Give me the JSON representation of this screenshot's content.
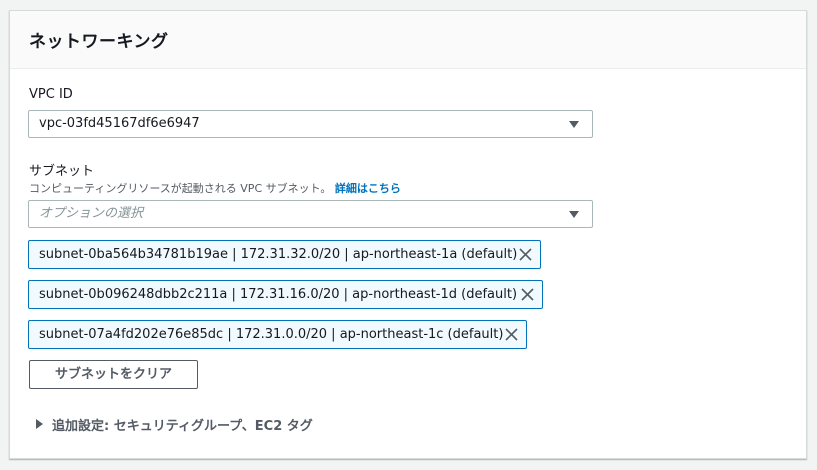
{
  "section": {
    "title": "ネットワーキング"
  },
  "vpc": {
    "label": "VPC ID",
    "value": "vpc-03fd45167df6e6947"
  },
  "subnet": {
    "label": "サブネット",
    "description": "コンピューティングリソースが起動される VPC サブネット。",
    "learn_more": "詳細はこちら",
    "placeholder": "オプションの選択",
    "selected": [
      "subnet-0ba564b34781b19ae | 172.31.32.0/20 | ap-northeast-1a (default)",
      "subnet-0b096248dbb2c211a | 172.31.16.0/20 | ap-northeast-1d (default)",
      "subnet-07a4fd202e76e85dc | 172.31.0.0/20 | ap-northeast-1c (default)"
    ],
    "clear_button": "サブネットをクリア"
  },
  "additional": {
    "label": "追加設定: セキュリティグループ、EC2 タグ"
  }
}
